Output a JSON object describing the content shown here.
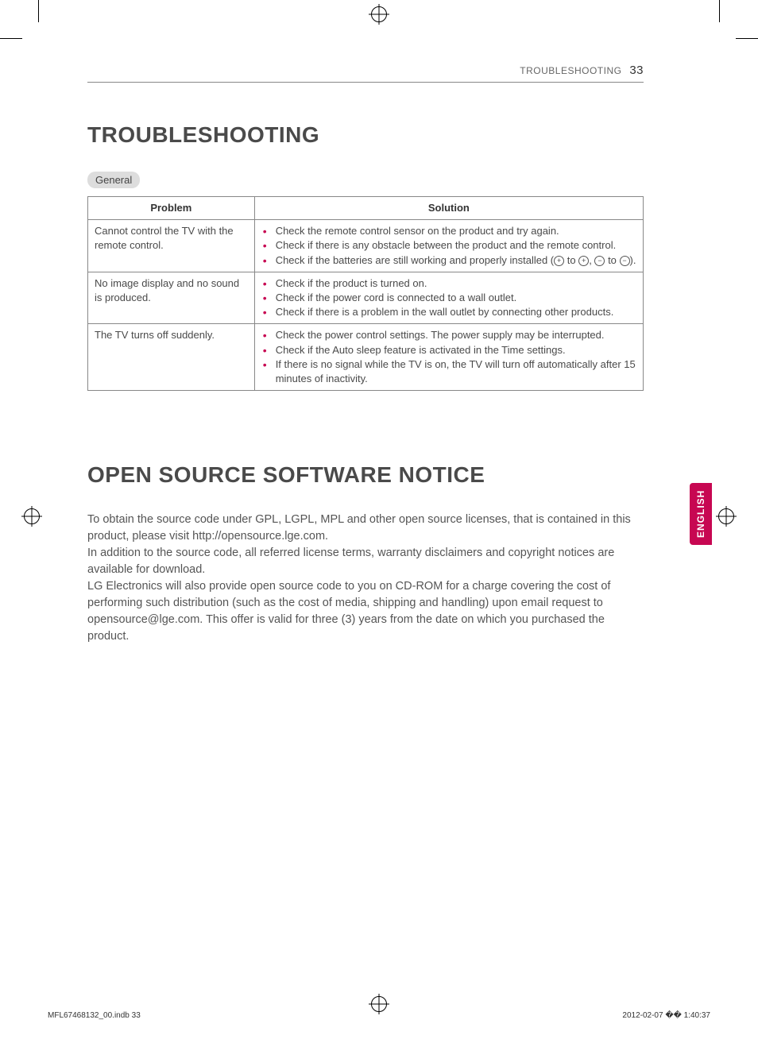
{
  "header": {
    "section": "TROUBLESHOOTING",
    "page": "33"
  },
  "h1a": "TROUBLESHOOTING",
  "tag": "General",
  "table": {
    "head": {
      "problem": "Problem",
      "solution": "Solution"
    },
    "rows": [
      {
        "problem": "Cannot control the TV with the remote control.",
        "solutions": [
          "Check the remote control sensor on the product and try again.",
          "Check if there is any obstacle between the product and the remote control.",
          "Check if the batteries are still working and properly installed (⊕ to ⊕, ⊖ to ⊖)."
        ]
      },
      {
        "problem": "No image display and no sound is produced.",
        "solutions": [
          "Check if the product is turned on.",
          "Check if the power cord is connected to a wall outlet.",
          "Check if there is a problem in the wall outlet by connecting other products."
        ]
      },
      {
        "problem": "The TV turns off suddenly.",
        "solutions": [
          "Check the power control settings. The power supply may be interrupted.",
          "Check if the Auto sleep feature is activated in the Time settings.",
          "If there is no signal while the TV is on, the TV will turn off automatically after 15 minutes of inactivity."
        ]
      }
    ]
  },
  "h1b": "OPEN SOURCE SOFTWARE NOTICE",
  "notice": {
    "p1": "To obtain the source code under GPL, LGPL, MPL and other open source licenses, that is contained in this product, please visit http://opensource.lge.com.",
    "p2": "In addition to the source code, all referred license terms, warranty disclaimers and copyright notices are available for download.",
    "p3": "LG Electronics will also provide open source code to you on CD-ROM for a charge covering the cost of performing such distribution (such as the cost of media, shipping and handling) upon email request to opensource@lge.com. This offer is valid for three (3) years from the date on which you purchased the product."
  },
  "langTab": "ENGLISH",
  "footer": {
    "left": "MFL67468132_00.indb   33",
    "right": "2012-02-07   �� 1:40:37"
  }
}
